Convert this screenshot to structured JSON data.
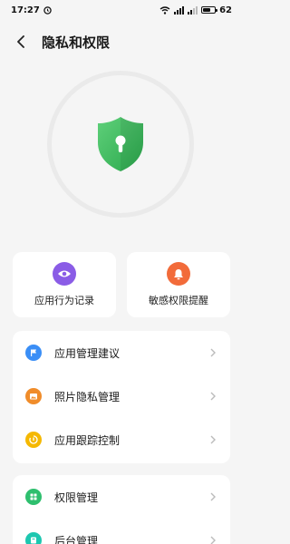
{
  "status_bar": {
    "time": "17:27",
    "battery": "62",
    "battery_level": 0.62
  },
  "header": {
    "title": "隐私和权限"
  },
  "hero": {
    "icon": "shield-lock-icon",
    "colors": {
      "shield": "#3fbf5f",
      "ring": "#eaeaea"
    }
  },
  "quick_cards": [
    {
      "label": "应用行为记录",
      "icon": "eye-icon",
      "color": "#8a5ce6"
    },
    {
      "label": "敏感权限提醒",
      "icon": "bell-icon",
      "color": "#f26b3a"
    }
  ],
  "groups": [
    {
      "items": [
        {
          "label": "应用管理建议",
          "icon": "flag-icon",
          "color": "#3a8ef6"
        },
        {
          "label": "照片隐私管理",
          "icon": "image-icon",
          "color": "#f08c2a"
        },
        {
          "label": "应用跟踪控制",
          "icon": "tracking-icon",
          "color": "#f5b800"
        }
      ]
    },
    {
      "items": [
        {
          "label": "权限管理",
          "icon": "grid-icon",
          "color": "#2ebf6e"
        },
        {
          "label": "后台管理",
          "icon": "background-icon",
          "color": "#1dc7b0"
        }
      ]
    }
  ]
}
